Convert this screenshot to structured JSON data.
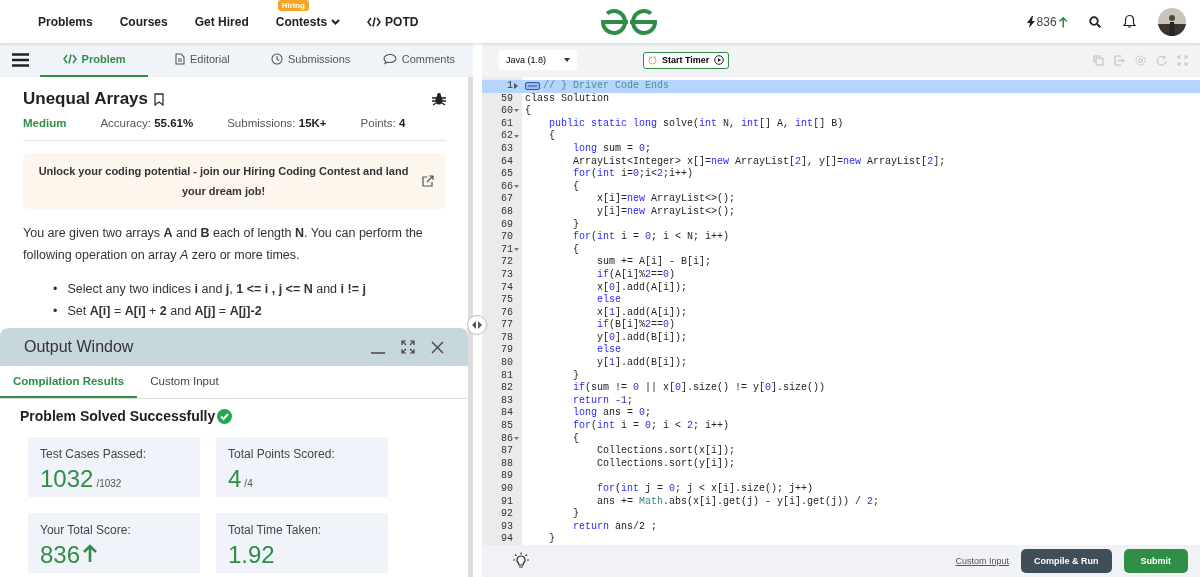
{
  "nav": {
    "links": [
      {
        "label": "Problems",
        "kind": "plain"
      },
      {
        "label": "Courses",
        "kind": "plain"
      },
      {
        "label": "Get Hired",
        "kind": "plain"
      },
      {
        "label": "Contests",
        "badge": "Hiring",
        "kind": "dropdown"
      },
      {
        "label": "POTD",
        "kind": "code"
      }
    ],
    "streak": {
      "value": "836",
      "rising": true
    }
  },
  "tabs": [
    {
      "label": "Problem",
      "selected": true
    },
    {
      "label": "Editorial",
      "selected": false
    },
    {
      "label": "Submissions",
      "selected": false
    },
    {
      "label": "Comments",
      "selected": false
    }
  ],
  "problem": {
    "title": "Unequal Arrays",
    "difficulty": "Medium",
    "meta": [
      {
        "label": "Accuracy:",
        "value": "55.61%"
      },
      {
        "label": "Submissions:",
        "value": "15K+"
      },
      {
        "label": "Points:",
        "value": "4"
      }
    ],
    "banner": "Unlock your coding potential - join our Hiring Coding Contest and land your dream job!",
    "statement": "You are given two arrays **A** and **B** each of length **N**. You can perform the following operation on array *A* zero or more times.",
    "bullets": [
      {
        "marker": "•",
        "text": "Select any two indices **i** and **j**, **1 <= i , j <= N** and **i != j**"
      },
      {
        "marker": "•",
        "text": "Set **A[i]** = **A[i]** + **2** and **A[j]** = **A[j]-2**"
      }
    ]
  },
  "output_window": {
    "title": "Output Window",
    "tabs": [
      {
        "label": "Compilation Results",
        "selected": true
      },
      {
        "label": "Custom Input",
        "selected": false
      }
    ],
    "status": "Problem Solved Successfully",
    "stats": [
      {
        "label": "Test Cases Passed:",
        "value": "1032",
        "total": "/1032"
      },
      {
        "label": "Total Points Scored:",
        "value": "4",
        "total": "/4"
      },
      {
        "label": "Your Total Score:",
        "value": "836",
        "rising": true
      },
      {
        "label": "Total Time Taken:",
        "value": "1.92"
      }
    ]
  },
  "editor": {
    "language": "Java (1.8)",
    "timer_button": "Start Timer",
    "lines": [
      {
        "number": "1",
        "collapsed": true,
        "highlighted": true,
        "segments": [
          {
            "kind": "comment",
            "text": "// } Driver Code Ends"
          }
        ]
      },
      {
        "number": "59",
        "highlighted": false,
        "segments": [
          {
            "kind": "plain",
            "text": "class Solution"
          }
        ]
      },
      {
        "number": "60",
        "collapsed": false,
        "highlighted": false,
        "segments": [
          {
            "kind": "plain",
            "text": "{"
          }
        ]
      },
      {
        "number": "61",
        "highlighted": false,
        "segments": [
          {
            "kind": "keyword",
            "text": "    public static long"
          },
          {
            "kind": "plain",
            "text": " solve("
          },
          {
            "kind": "keyword",
            "text": "int"
          },
          {
            "kind": "plain",
            "text": " N, "
          },
          {
            "kind": "keyword",
            "text": "int"
          },
          {
            "kind": "plain",
            "text": "[] A, "
          },
          {
            "kind": "keyword",
            "text": "int"
          },
          {
            "kind": "plain",
            "text": "[] B)"
          }
        ]
      },
      {
        "number": "62",
        "collapsed": false,
        "highlighted": false,
        "segments": [
          {
            "kind": "plain",
            "text": "    {"
          }
        ]
      },
      {
        "number": "63",
        "highlighted": false,
        "segments": [
          {
            "kind": "keyword",
            "text": "        long"
          },
          {
            "kind": "plain",
            "text": " sum = "
          },
          {
            "kind": "number",
            "text": "0"
          },
          {
            "kind": "plain",
            "text": ";"
          }
        ]
      },
      {
        "number": "64",
        "highlighted": false,
        "segments": [
          {
            "kind": "plain",
            "text": "        ArrayList<Integer> x[]="
          },
          {
            "kind": "keyword",
            "text": "new"
          },
          {
            "kind": "plain",
            "text": " ArrayList["
          },
          {
            "kind": "number",
            "text": "2"
          },
          {
            "kind": "plain",
            "text": "], y[]="
          },
          {
            "kind": "keyword",
            "text": "new"
          },
          {
            "kind": "plain",
            "text": " ArrayList["
          },
          {
            "kind": "number",
            "text": "2"
          },
          {
            "kind": "plain",
            "text": "];"
          }
        ]
      },
      {
        "number": "65",
        "highlighted": false,
        "segments": [
          {
            "kind": "keyword",
            "text": "        for"
          },
          {
            "kind": "plain",
            "text": "("
          },
          {
            "kind": "keyword",
            "text": "int"
          },
          {
            "kind": "plain",
            "text": " i="
          },
          {
            "kind": "number",
            "text": "0"
          },
          {
            "kind": "plain",
            "text": ";i<"
          },
          {
            "kind": "number",
            "text": "2"
          },
          {
            "kind": "plain",
            "text": ";i++)"
          }
        ]
      },
      {
        "number": "66",
        "collapsed": false,
        "highlighted": false,
        "segments": [
          {
            "kind": "plain",
            "text": "        {"
          }
        ]
      },
      {
        "number": "67",
        "highlighted": false,
        "segments": [
          {
            "kind": "plain",
            "text": "            x[i]="
          },
          {
            "kind": "keyword",
            "text": "new"
          },
          {
            "kind": "plain",
            "text": " ArrayList<>();"
          }
        ]
      },
      {
        "number": "68",
        "highlighted": false,
        "segments": [
          {
            "kind": "plain",
            "text": "            y[i]="
          },
          {
            "kind": "keyword",
            "text": "new"
          },
          {
            "kind": "plain",
            "text": " ArrayList<>();"
          }
        ]
      },
      {
        "number": "69",
        "highlighted": false,
        "segments": [
          {
            "kind": "plain",
            "text": "        }"
          }
        ]
      },
      {
        "number": "70",
        "highlighted": false,
        "segments": [
          {
            "kind": "keyword",
            "text": "        for"
          },
          {
            "kind": "plain",
            "text": "("
          },
          {
            "kind": "keyword",
            "text": "int"
          },
          {
            "kind": "plain",
            "text": " i = "
          },
          {
            "kind": "number",
            "text": "0"
          },
          {
            "kind": "plain",
            "text": "; i < N; i++)"
          }
        ]
      },
      {
        "number": "71",
        "collapsed": false,
        "highlighted": false,
        "segments": [
          {
            "kind": "plain",
            "text": "        {"
          }
        ]
      },
      {
        "number": "72",
        "highlighted": false,
        "segments": [
          {
            "kind": "plain",
            "text": "            sum += A[i] - B[i];"
          }
        ]
      },
      {
        "number": "73",
        "highlighted": false,
        "segments": [
          {
            "kind": "keyword",
            "text": "            if"
          },
          {
            "kind": "plain",
            "text": "(A[i]%"
          },
          {
            "kind": "number",
            "text": "2"
          },
          {
            "kind": "plain",
            "text": "=="
          },
          {
            "kind": "number",
            "text": "0"
          },
          {
            "kind": "plain",
            "text": ")"
          }
        ]
      },
      {
        "number": "74",
        "highlighted": false,
        "segments": [
          {
            "kind": "plain",
            "text": "            x["
          },
          {
            "kind": "number",
            "text": "0"
          },
          {
            "kind": "plain",
            "text": "].add(A[i]);"
          }
        ]
      },
      {
        "number": "75",
        "highlighted": false,
        "segments": [
          {
            "kind": "keyword",
            "text": "            else"
          }
        ]
      },
      {
        "number": "76",
        "highlighted": false,
        "segments": [
          {
            "kind": "plain",
            "text": "            x["
          },
          {
            "kind": "number",
            "text": "1"
          },
          {
            "kind": "plain",
            "text": "].add(A[i]);"
          }
        ]
      },
      {
        "number": "77",
        "highlighted": false,
        "segments": [
          {
            "kind": "keyword",
            "text": "            if"
          },
          {
            "kind": "plain",
            "text": "(B[i]%"
          },
          {
            "kind": "number",
            "text": "2"
          },
          {
            "kind": "plain",
            "text": "=="
          },
          {
            "kind": "number",
            "text": "0"
          },
          {
            "kind": "plain",
            "text": ")"
          }
        ]
      },
      {
        "number": "78",
        "highlighted": false,
        "segments": [
          {
            "kind": "plain",
            "text": "            y["
          },
          {
            "kind": "number",
            "text": "0"
          },
          {
            "kind": "plain",
            "text": "].add(B[i]);"
          }
        ]
      },
      {
        "number": "79",
        "highlighted": false,
        "segments": [
          {
            "kind": "keyword",
            "text": "            else"
          }
        ]
      },
      {
        "number": "80",
        "highlighted": false,
        "segments": [
          {
            "kind": "plain",
            "text": "            y["
          },
          {
            "kind": "number",
            "text": "1"
          },
          {
            "kind": "plain",
            "text": "].add(B[i]);"
          }
        ]
      },
      {
        "number": "81",
        "highlighted": false,
        "segments": [
          {
            "kind": "plain",
            "text": "        }"
          }
        ]
      },
      {
        "number": "82",
        "highlighted": false,
        "segments": [
          {
            "kind": "keyword",
            "text": "        if"
          },
          {
            "kind": "plain",
            "text": "(sum != "
          },
          {
            "kind": "number",
            "text": "0"
          },
          {
            "kind": "plain",
            "text": " || x["
          },
          {
            "kind": "number",
            "text": "0"
          },
          {
            "kind": "plain",
            "text": "].size() != y["
          },
          {
            "kind": "number",
            "text": "0"
          },
          {
            "kind": "plain",
            "text": "].size())"
          }
        ]
      },
      {
        "number": "83",
        "highlighted": false,
        "segments": [
          {
            "kind": "keyword",
            "text": "        return"
          },
          {
            "kind": "number",
            "text": " -1"
          },
          {
            "kind": "plain",
            "text": ";"
          }
        ]
      },
      {
        "number": "84",
        "highlighted": false,
        "segments": [
          {
            "kind": "keyword",
            "text": "        long"
          },
          {
            "kind": "plain",
            "text": " ans = "
          },
          {
            "kind": "number",
            "text": "0"
          },
          {
            "kind": "plain",
            "text": ";"
          }
        ]
      },
      {
        "number": "85",
        "highlighted": false,
        "segments": [
          {
            "kind": "keyword",
            "text": "        for"
          },
          {
            "kind": "plain",
            "text": "("
          },
          {
            "kind": "keyword",
            "text": "int"
          },
          {
            "kind": "plain",
            "text": " i = "
          },
          {
            "kind": "number",
            "text": "0"
          },
          {
            "kind": "plain",
            "text": "; i < "
          },
          {
            "kind": "number",
            "text": "2"
          },
          {
            "kind": "plain",
            "text": "; i++)"
          }
        ]
      },
      {
        "number": "86",
        "collapsed": false,
        "highlighted": false,
        "segments": [
          {
            "kind": "plain",
            "text": "        {"
          }
        ]
      },
      {
        "number": "87",
        "highlighted": false,
        "segments": [
          {
            "kind": "plain",
            "text": "            Collections.sort(x[i]);"
          }
        ]
      },
      {
        "number": "88",
        "highlighted": false,
        "segments": [
          {
            "kind": "plain",
            "text": "            Collections.sort(y[i]);"
          }
        ]
      },
      {
        "number": "89",
        "highlighted": false
      },
      {
        "number": "90",
        "highlighted": false,
        "segments": [
          {
            "kind": "keyword",
            "text": "            for"
          },
          {
            "kind": "plain",
            "text": "("
          },
          {
            "kind": "keyword",
            "text": "int"
          },
          {
            "kind": "plain",
            "text": " j = "
          },
          {
            "kind": "number",
            "text": "0"
          },
          {
            "kind": "plain",
            "text": "; j < x[i].size(); j++)"
          }
        ]
      },
      {
        "number": "91",
        "highlighted": false,
        "segments": [
          {
            "kind": "plain",
            "text": "            ans += "
          },
          {
            "kind": "type",
            "text": "Math"
          },
          {
            "kind": "plain",
            "text": ".abs(x[i].get(j) - y[i].get(j)) / "
          },
          {
            "kind": "number",
            "text": "2"
          },
          {
            "kind": "plain",
            "text": ";"
          }
        ]
      },
      {
        "number": "92",
        "highlighted": false,
        "segments": [
          {
            "kind": "plain",
            "text": "        }"
          }
        ]
      },
      {
        "number": "93",
        "highlighted": false,
        "segments": [
          {
            "kind": "keyword",
            "text": "        return"
          },
          {
            "kind": "plain",
            "text": " ans/2 ;"
          }
        ]
      },
      {
        "number": "94",
        "highlighted": false,
        "segments": [
          {
            "kind": "plain",
            "text": "    }"
          }
        ]
      }
    ],
    "custom_input_link": "Custom Input",
    "compile_button": "Compile & Run",
    "submit_button": "Submit"
  }
}
